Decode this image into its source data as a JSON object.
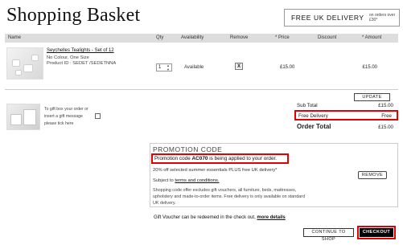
{
  "header": {
    "title": "Shopping Basket",
    "delivery_badge": "FREE UK DELIVERY",
    "delivery_note": "on orders over £30*"
  },
  "table": {
    "columns": [
      "Name",
      "Qty",
      "Availability",
      "Remove",
      "* Price",
      "Discount",
      "* Amount"
    ]
  },
  "item": {
    "name": "Seychelles Tealights - Set of 12",
    "variant": "No Colour, One Size",
    "product_id": "Product ID : SEDET /SEDETNNA",
    "qty": "1",
    "availability": "Available",
    "remove": "X",
    "price": "£15.00",
    "amount": "£15.00"
  },
  "update_label": "UPDATE",
  "gift": {
    "text": "To gift box your order or insert a gift message please tick here"
  },
  "totals": {
    "subtotal_label": "Sub Total",
    "subtotal_value": "£15.00",
    "delivery_label": "Free Delivery",
    "delivery_value": "Free",
    "order_label": "Order Total",
    "order_value": "£15.00"
  },
  "promo": {
    "heading": "PROMOTION CODE",
    "applied_prefix": "Promotion code ",
    "code": "AC070",
    "applied_suffix": " is being applied to your order.",
    "offer": "20% off selected summer essentials PLUS free UK delivery*",
    "subject_prefix": "Subject to ",
    "terms_link": "terms and conditions.",
    "exclusions": "Shopping code offer excludes gift vouchers, all furniture, beds, mattresses, upholstery and made-to-order items. Free delivery is only available on standard UK delivery.",
    "remove_label": "REMOVE"
  },
  "voucher": {
    "text": "Gift Voucher can be redeemed in the check out, ",
    "link": "more details"
  },
  "actions": {
    "continue_label": "CONTINUE TO SHOP",
    "checkout_label": "CHECKOUT"
  }
}
